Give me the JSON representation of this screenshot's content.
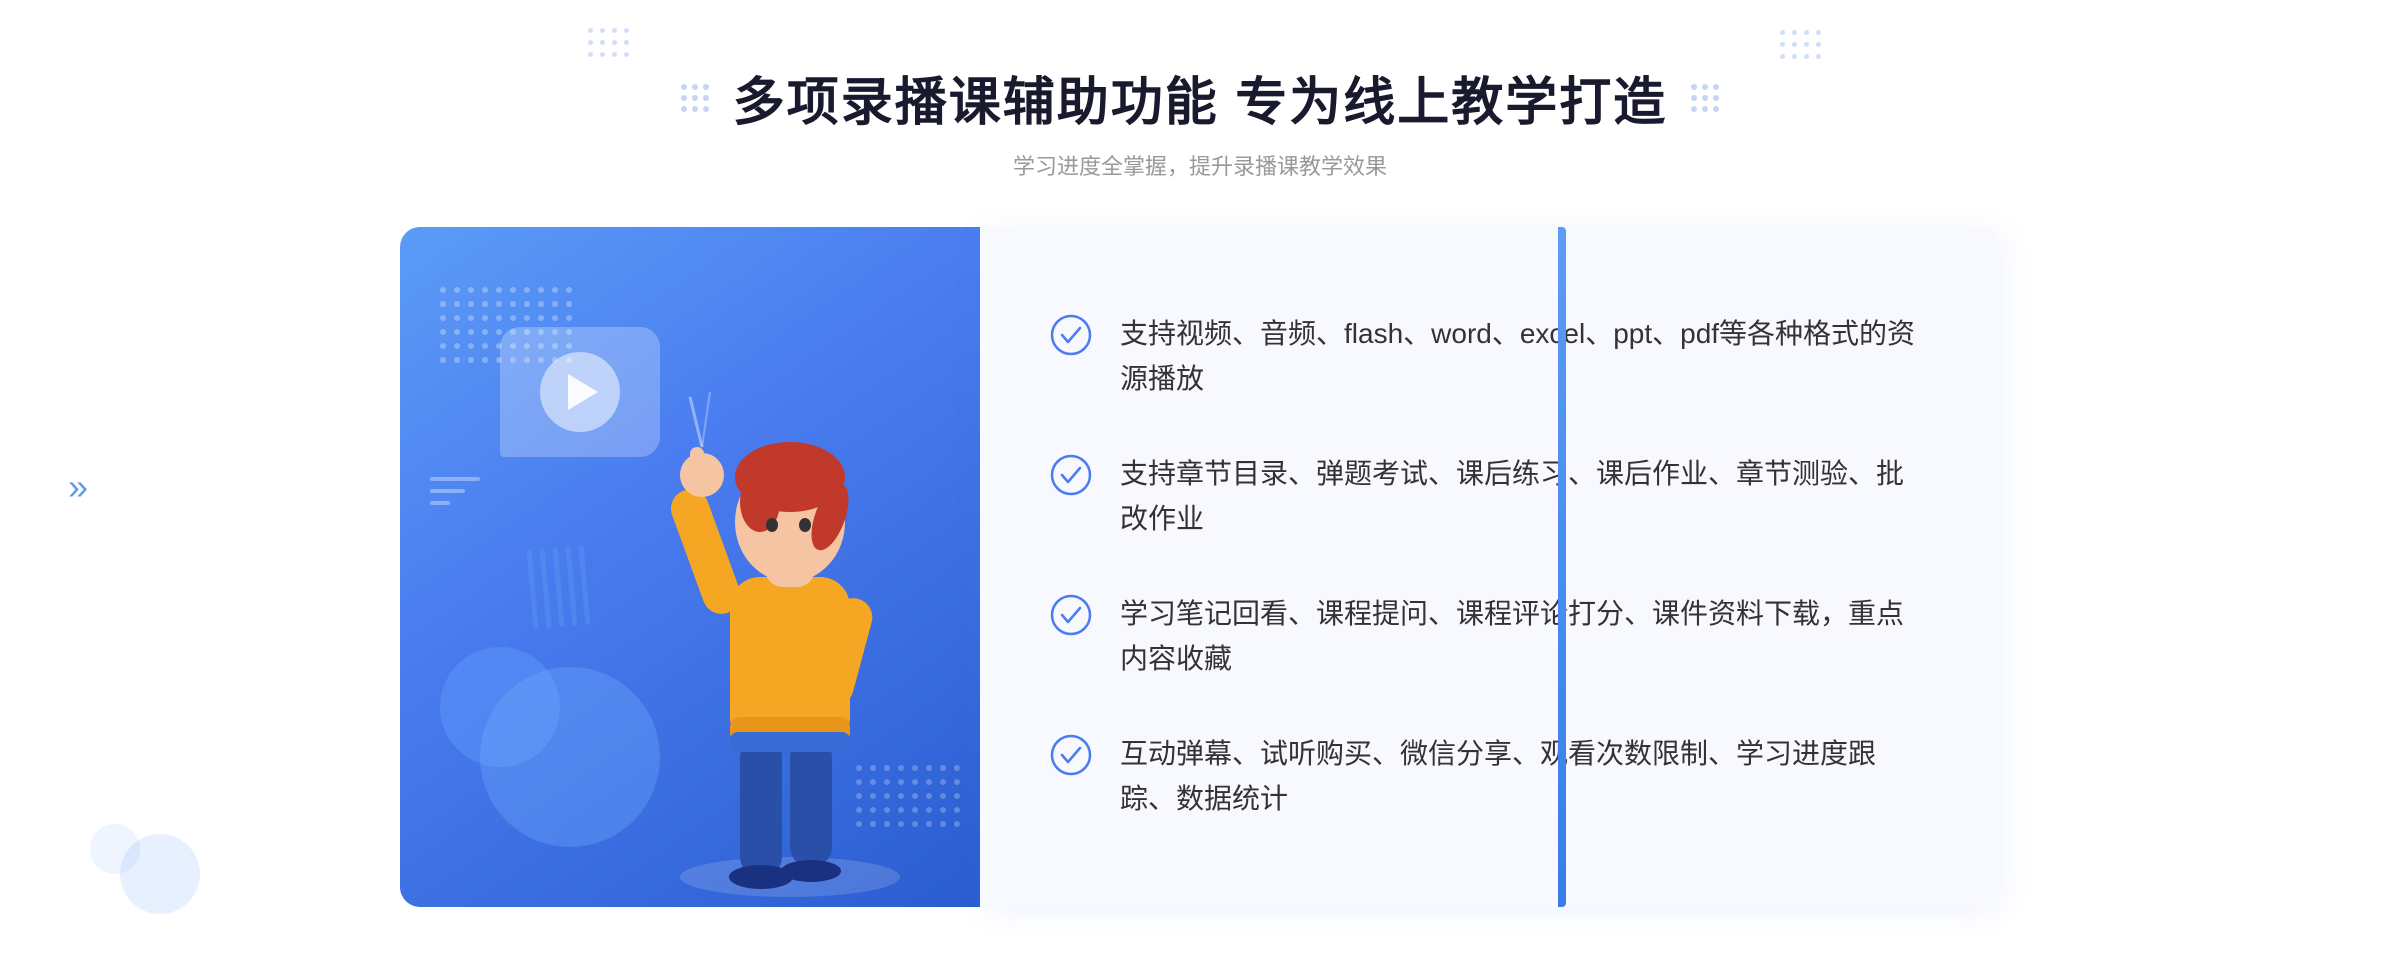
{
  "page": {
    "title": "多项录播课辅助功能 专为线上教学打造",
    "subtitle": "学习进度全掌握，提升录播课教学效果"
  },
  "features": [
    {
      "id": "feature-1",
      "text": "支持视频、音频、flash、word、excel、ppt、pdf等各种格式的资源播放"
    },
    {
      "id": "feature-2",
      "text": "支持章节目录、弹题考试、课后练习、课后作业、章节测验、批改作业"
    },
    {
      "id": "feature-3",
      "text": "学习笔记回看、课程提问、课程评论打分、课件资料下载，重点内容收藏"
    },
    {
      "id": "feature-4",
      "text": "互动弹幕、试听购买、微信分享、观看次数限制、学习进度跟踪、数据统计"
    }
  ],
  "colors": {
    "primary": "#4a7cf0",
    "check": "#4a7cf0",
    "title": "#1a1a2e",
    "subtitle": "#999999",
    "feature_text": "#333333"
  }
}
